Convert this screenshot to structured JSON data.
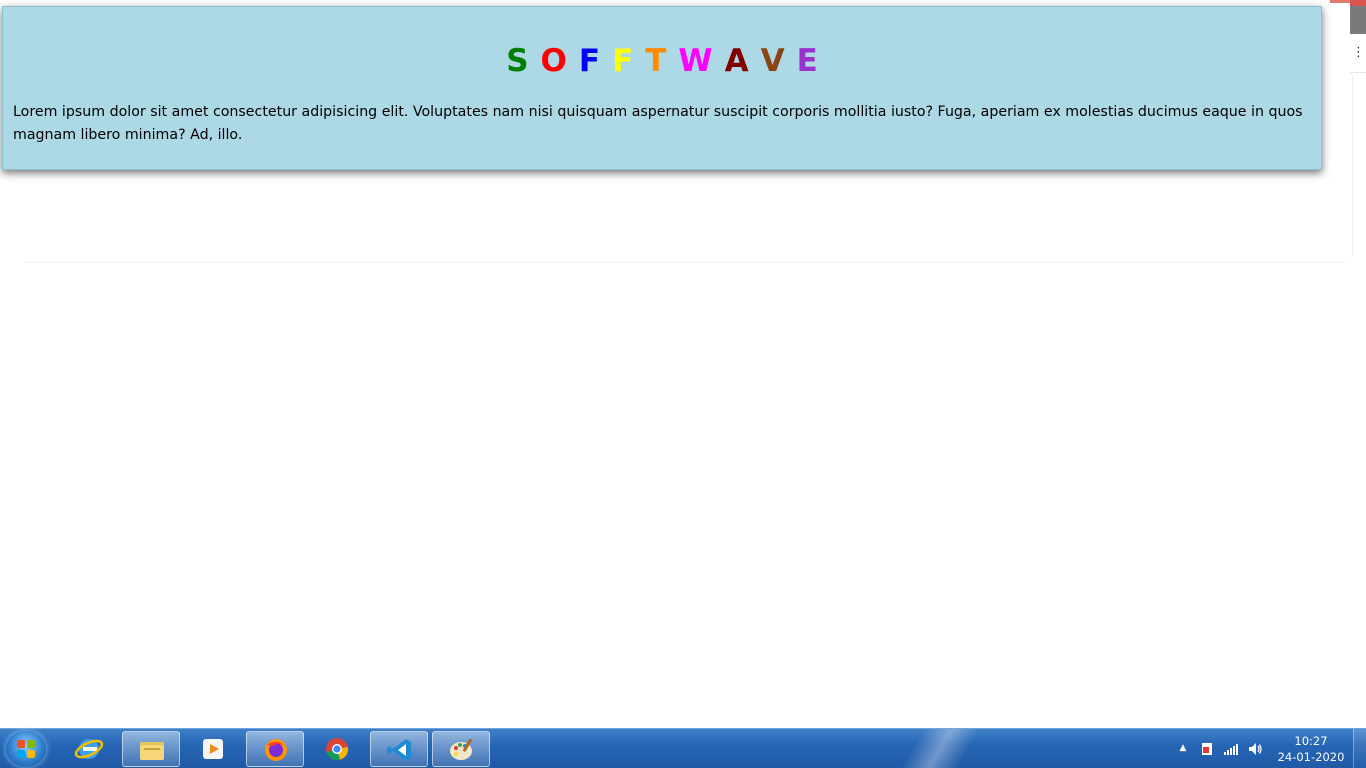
{
  "page": {
    "title_letters": [
      {
        "char": "S",
        "color": "#008000"
      },
      {
        "char": "O",
        "color": "#ff0000"
      },
      {
        "char": "F",
        "color": "#0000ff"
      },
      {
        "char": "F",
        "color": "#ffff00"
      },
      {
        "char": "T",
        "color": "#ff8c00"
      },
      {
        "char": "W",
        "color": "#ff00ff"
      },
      {
        "char": "A",
        "color": "#800000"
      },
      {
        "char": "V",
        "color": "#8b4513"
      },
      {
        "char": "E",
        "color": "#9932cc"
      }
    ],
    "paragraph": "Lorem ipsum dolor sit amet consectetur adipisicing elit. Voluptates nam nisi quisquam aspernatur suscipit corporis mollitia iusto? Fuga, aperiam ex molestias ducimus eaque in quos magnam libero minima? Ad, illo.",
    "card_color": "#add8e6"
  },
  "browser": {
    "menu_icon": "menu-dots-icon"
  },
  "taskbar": {
    "start_icon": "windows-start-icon",
    "apps": [
      {
        "name": "internet-explorer-icon",
        "active": false
      },
      {
        "name": "file-explorer-icon",
        "active": true
      },
      {
        "name": "media-player-icon",
        "active": false
      },
      {
        "name": "firefox-icon",
        "active": true
      },
      {
        "name": "chrome-icon",
        "active": false
      },
      {
        "name": "vscode-icon",
        "active": true
      },
      {
        "name": "paint-icon",
        "active": true
      }
    ],
    "tray": {
      "show_hidden_icon": "chevron-up-icon",
      "icons": [
        "action-center-icon",
        "network-signal-icon",
        "volume-icon"
      ]
    },
    "clock": {
      "time": "10:27",
      "date": "24-01-2020"
    }
  }
}
